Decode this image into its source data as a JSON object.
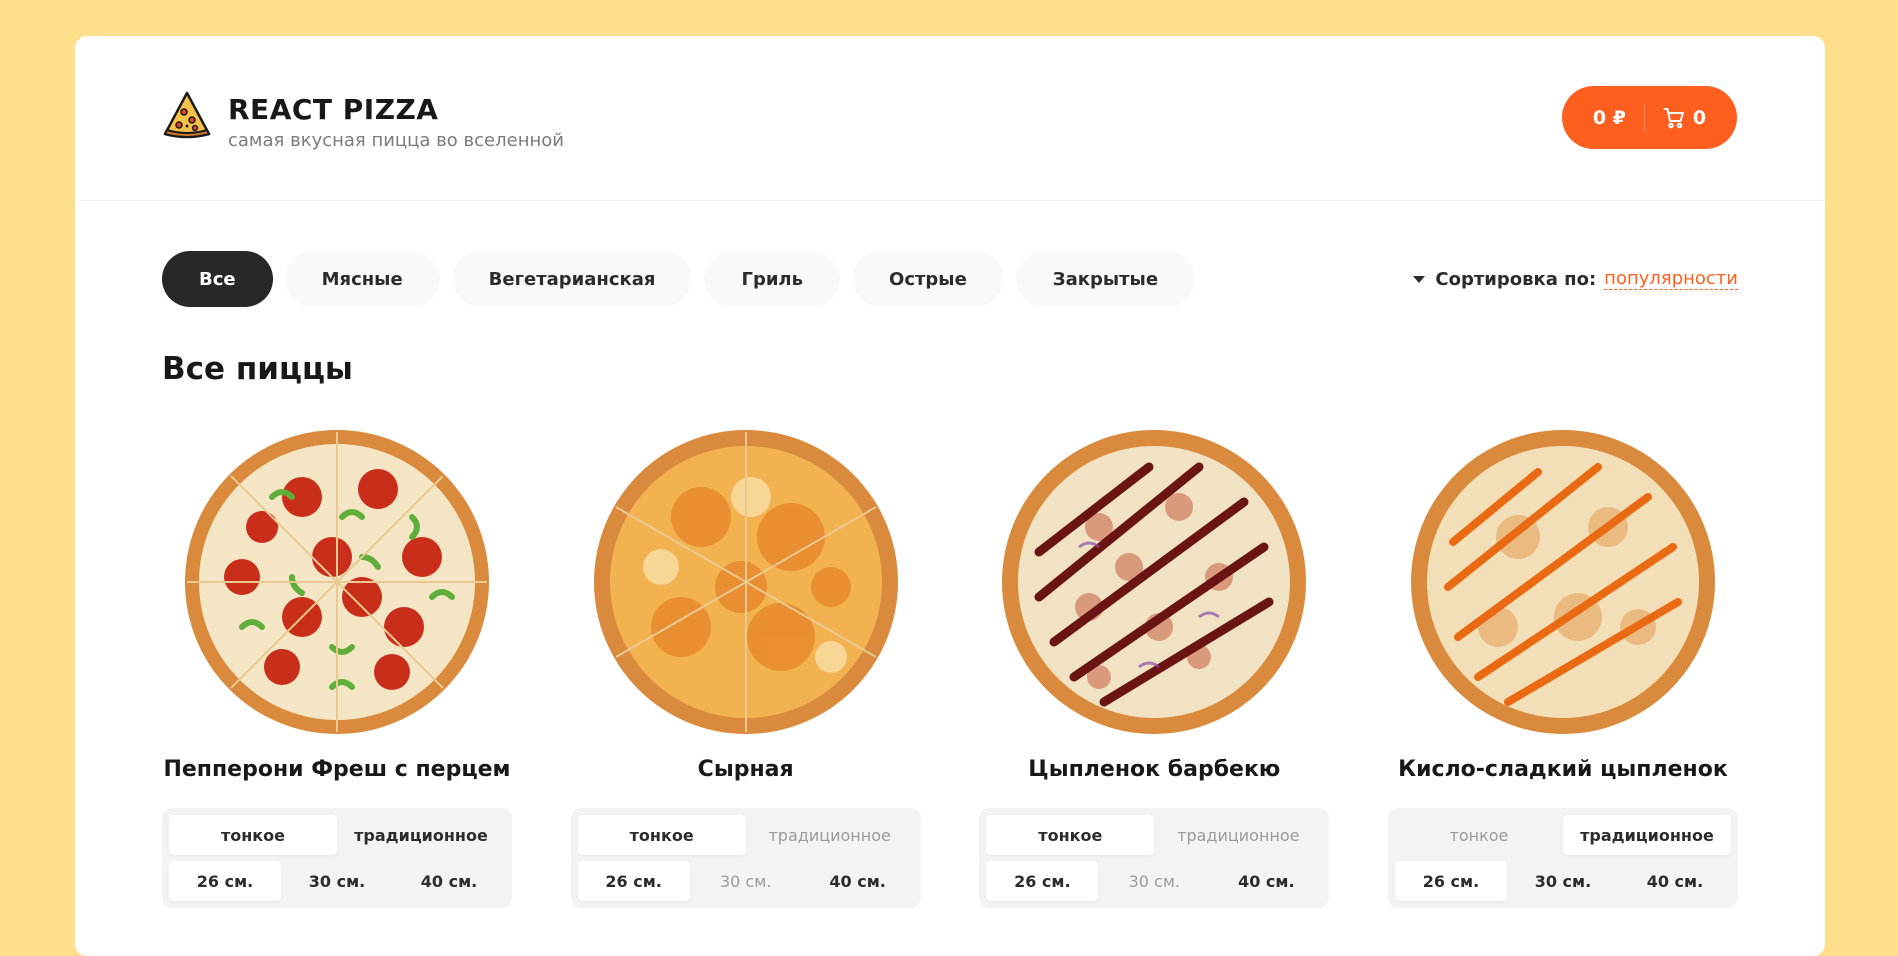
{
  "brand": {
    "title": "REACT PIZZA",
    "subtitle": "самая вкусная пицца во вселенной"
  },
  "cart": {
    "price": "0 ₽",
    "count": "0"
  },
  "categories": [
    "Все",
    "Мясные",
    "Вегетарианская",
    "Гриль",
    "Острые",
    "Закрытые"
  ],
  "active_category": "Все",
  "sort": {
    "label": "Сортировка по:",
    "value": "популярности"
  },
  "section_title": "Все пиццы",
  "pizzas": [
    {
      "name": "Пепперони Фреш с перцем",
      "types": [
        "тонкое",
        "традиционное"
      ],
      "selected_type": "тонкое",
      "disabled_types": [],
      "sizes": [
        "26 см.",
        "30 см.",
        "40 см."
      ],
      "selected_size": "26 см.",
      "disabled_sizes": []
    },
    {
      "name": "Сырная",
      "types": [
        "тонкое",
        "традиционное"
      ],
      "selected_type": "тонкое",
      "disabled_types": [
        "традиционное"
      ],
      "sizes": [
        "26 см.",
        "30 см.",
        "40 см."
      ],
      "selected_size": "26 см.",
      "disabled_sizes": [
        "30 см."
      ]
    },
    {
      "name": "Цыпленок барбекю",
      "types": [
        "тонкое",
        "традиционное"
      ],
      "selected_type": "тонкое",
      "disabled_types": [
        "традиционное"
      ],
      "sizes": [
        "26 см.",
        "30 см.",
        "40 см."
      ],
      "selected_size": "26 см.",
      "disabled_sizes": [
        "30 см."
      ]
    },
    {
      "name": "Кисло-сладкий цыпленок",
      "types": [
        "тонкое",
        "традиционное"
      ],
      "selected_type": "традиционное",
      "disabled_types": [
        "тонкое"
      ],
      "sizes": [
        "26 см.",
        "30 см.",
        "40 см."
      ],
      "selected_size": "26 см.",
      "disabled_sizes": []
    }
  ],
  "colors": {
    "accent": "#fe5f1e",
    "background": "#ffdf8c",
    "active_category": "#282828"
  },
  "icons": {
    "logo": "pizza-slice-icon",
    "cart": "cart-icon",
    "sort": "triangle-down-icon"
  }
}
